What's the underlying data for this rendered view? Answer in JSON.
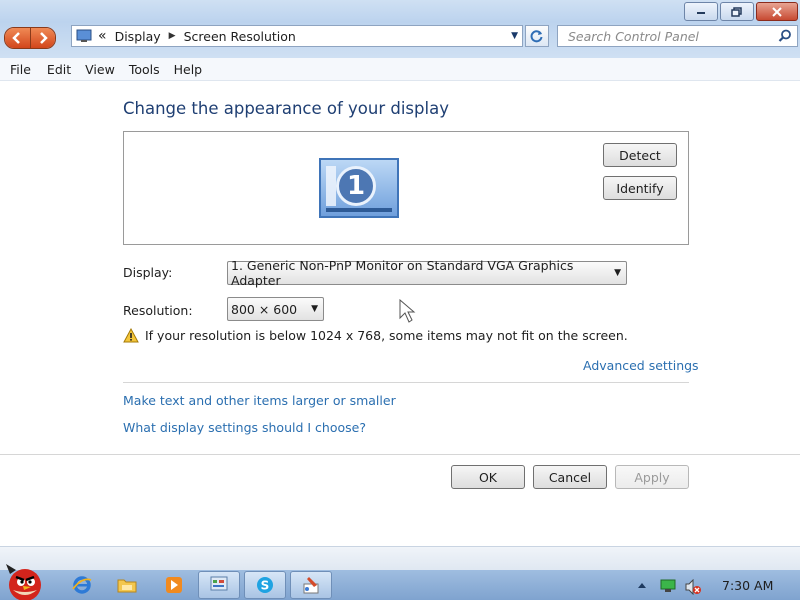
{
  "window": {
    "controls": {
      "minimize_icon": "minimize-icon",
      "restore_icon": "restore-icon",
      "close_icon": "close-icon"
    }
  },
  "address_bar": {
    "prefix": "«",
    "breadcrumbs": [
      "Display",
      "Screen Resolution"
    ],
    "search_placeholder": "Search Control Panel"
  },
  "menu": [
    "File",
    "Edit",
    "View",
    "Tools",
    "Help"
  ],
  "main": {
    "heading": "Change the appearance of your display",
    "monitor_number": "1",
    "detect_label": "Detect",
    "identify_label": "Identify",
    "display_label": "Display:",
    "display_value": "1. Generic Non-PnP Monitor on Standard VGA Graphics Adapter",
    "resolution_label": "Resolution:",
    "resolution_value": "800 × 600",
    "warning_text": "If your resolution is below 1024 x 768, some items may not fit on the screen.",
    "advanced_link": "Advanced settings",
    "link_text_size": "Make text and other items larger or smaller",
    "link_help": "What display settings should I choose?"
  },
  "buttons": {
    "ok": "OK",
    "cancel": "Cancel",
    "apply": "Apply"
  },
  "taskbar": {
    "clock": "7:30 AM",
    "pinned_icons": [
      "angry-birds-icon",
      "internet-explorer-icon",
      "folder-icon",
      "media-player-icon",
      "control-panel-icon",
      "skype-icon",
      "paint-icon"
    ]
  },
  "colors": {
    "heading": "#1f3f73",
    "link": "#2b6fb0",
    "accent_nav": "#d2461c"
  }
}
